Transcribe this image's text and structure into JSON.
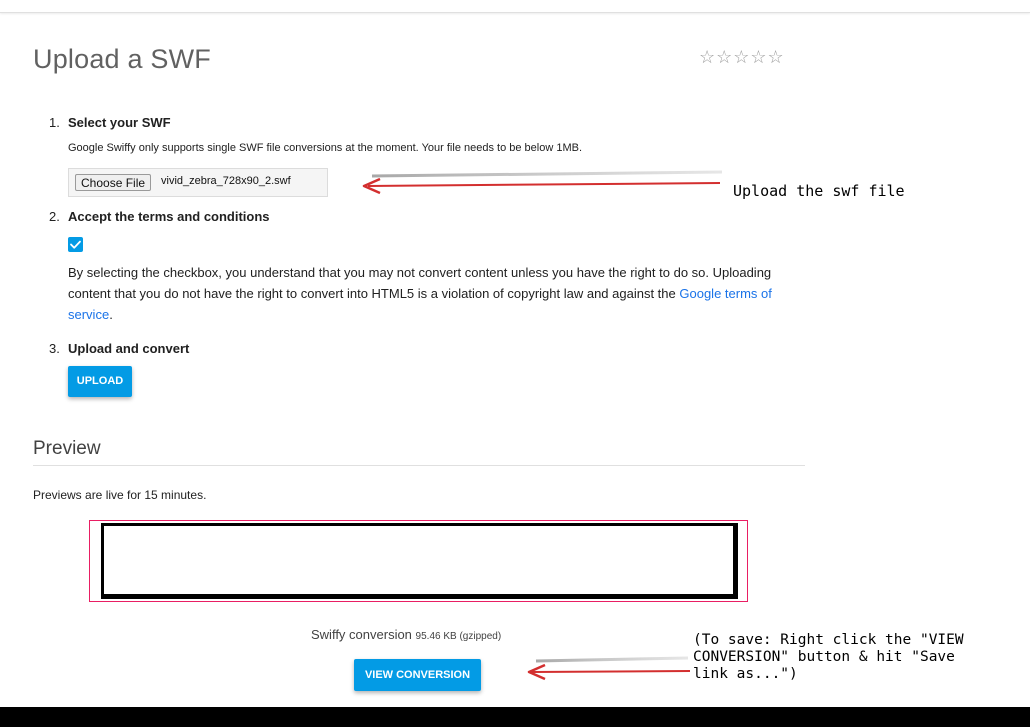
{
  "page": {
    "title": "Upload a SWF",
    "rating_stars": "☆☆☆☆☆"
  },
  "steps": [
    {
      "number": "1.",
      "title": "Select your SWF"
    },
    {
      "number": "2.",
      "title": "Accept the terms and conditions"
    },
    {
      "number": "3.",
      "title": "Upload and convert"
    }
  ],
  "select": {
    "info": "Google Swiffy only supports single SWF file conversions at the moment. Your file needs to be below 1MB.",
    "choose_label": "Choose File",
    "file_name": "vivid_zebra_728x90_2.swf"
  },
  "terms": {
    "checked": true,
    "text_before": "By selecting the checkbox, you understand that you may not convert content unless you have the right to do so. Uploading content that you do not have the right to convert into HTML5 is a violation of copyright law and against the ",
    "link_text": "Google terms of service",
    "text_after": "."
  },
  "upload": {
    "button_label": "UPLOAD"
  },
  "preview": {
    "title": "Preview",
    "note": "Previews are live for 15 minutes.",
    "conversion_label": "Swiffy conversion",
    "conversion_size": "95.46 KB (gzipped)",
    "view_button_label": "VIEW CONVERSION"
  },
  "annotations": {
    "upload_note": "Upload the swf file",
    "save_note_lines": [
      "(To save: Right click the \"VIEW",
      "CONVERSION\" button & hit \"Save",
      "link as...\")"
    ]
  },
  "colors": {
    "accent": "#039be5",
    "link": "#1a73e8",
    "arrow_red": "#d32f2f",
    "preview_border": "#e91e63"
  }
}
